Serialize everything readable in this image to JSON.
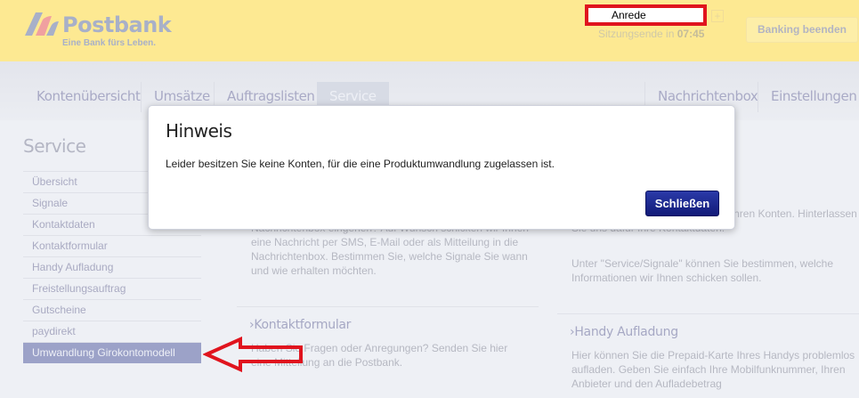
{
  "header": {
    "brand": "Postbank",
    "slogan": "Eine Bank fürs Leben.",
    "anrede": "Anrede",
    "add_label": "+",
    "session_label": "Sitzungsende in",
    "session_time": "07:45",
    "logout": "Banking beenden"
  },
  "nav": {
    "tabs": [
      "Kontenübersicht",
      "Umsätze",
      "Auftragslisten",
      "Service",
      "Nachrichtenbox",
      "Einstellungen"
    ],
    "active": "Service"
  },
  "sidebar": {
    "title": "Service",
    "items": [
      "Übersicht",
      "Signale",
      "Kontaktdaten",
      "Kontaktformular",
      "Handy Aufladung",
      "Freistellungsauftrag",
      "Gutscheine",
      "paydirekt",
      "Umwandlung Girokontomodell"
    ],
    "active": "Umwandlung Girokontomodell"
  },
  "content": {
    "signale_text": "Konten passiert oder wenn neue Mitteilungen in Ihrer Nachrichtenbox eingehen? Auf Wunsch schicken wir Ihnen eine Nachricht per SMS, E-Mail oder als Mitteilung in die Nachrichtenbox. Bestimmen Sie, welche Signale Sie wann und wie erhalten möchten.",
    "kontaktdaten_text": "tuell über wichtige Ereignisse auf Ihren Konten. Hinterlassen Sie uns dafür Ihre Kontaktdaten.",
    "kontaktdaten_text2": "Unter \"Service/Signale\" können Sie bestimmen, welche Informationen wir Ihnen schicken sollen.",
    "kontaktformular_title": "Kontaktformular",
    "kontaktformular_text": "Haben Sie Fragen oder Anregungen? Senden Sie hier eine Mitteilung an die Postbank.",
    "handy_title": "Handy Aufladung",
    "handy_text": "Hier können Sie die Prepaid-Karte Ihres Handys problemlos aufladen. Geben Sie einfach Ihre Mobilfunknummer, Ihren Anbieter und den Aufladebetrag"
  },
  "modal": {
    "title": "Hinweis",
    "message": "Leider besitzen Sie keine Konten, für die eine Produktumwandlung zugelassen ist.",
    "close": "Schließen"
  },
  "colors": {
    "annotation": "#e0141e",
    "header": "#fde992",
    "primary_button": "#1a2490"
  }
}
